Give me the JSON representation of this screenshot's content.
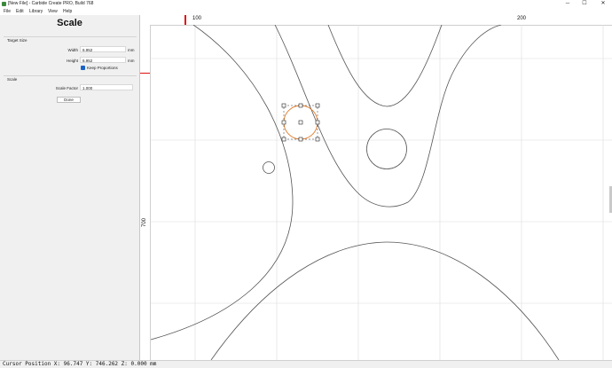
{
  "window": {
    "title": "[New File] - Carbide Create PRO, Build 768",
    "minimize_glyph": "─",
    "maximize_glyph": "☐",
    "close_glyph": "✕"
  },
  "menu": [
    "File",
    "Edit",
    "Library",
    "View",
    "Help"
  ],
  "panel": {
    "title": "Scale",
    "target_size_label": "Target Size",
    "width_label": "Width",
    "width_value": "6.952",
    "width_unit": "mm",
    "height_label": "Height",
    "height_value": "6.952",
    "height_unit": "mm",
    "keep_proportions_label": "Keep Proportions",
    "keep_proportions_checked": true,
    "scale_label": "Scale",
    "scale_factor_label": "Scale Factor",
    "scale_factor_value": "1.000",
    "done_label": "Done"
  },
  "rulers": {
    "top_labels": [
      "100",
      "200"
    ],
    "left_labels": [
      "700"
    ]
  },
  "status": {
    "cursor_text": "Cursor Position X: 96.747 Y: 746.262 Z: 0.000 mm"
  },
  "colors": {
    "selection": "#e07a28",
    "ruler_marker": "#e01010",
    "checkbox": "#1a63c6",
    "grid": "#dcdcdc",
    "geometry": "#555555"
  }
}
